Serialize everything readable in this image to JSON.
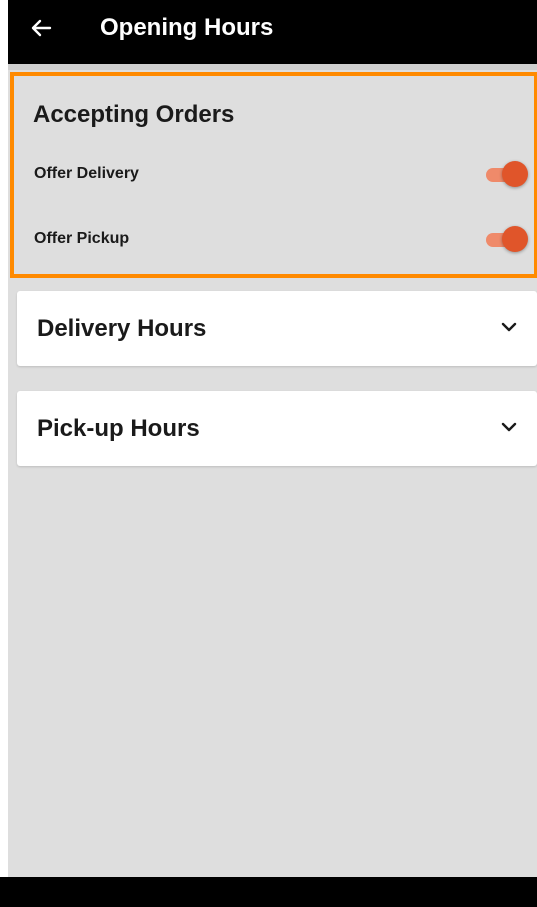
{
  "appbar": {
    "title": "Opening Hours",
    "back_icon": "arrow-left-icon"
  },
  "accepting_orders": {
    "title": "Accepting Orders",
    "accent_color": "#ff8a00",
    "toggles": [
      {
        "label": "Offer Delivery",
        "checked": true
      },
      {
        "label": "Offer Pickup",
        "checked": true
      }
    ]
  },
  "sections": [
    {
      "title": "Delivery Hours",
      "icon": "chevron-down-icon"
    },
    {
      "title": "Pick-up Hours",
      "icon": "chevron-down-icon"
    }
  ],
  "colors": {
    "toggle_on_thumb": "#e0552a",
    "toggle_on_track": "#ef8a6a",
    "background": "#dedede"
  }
}
